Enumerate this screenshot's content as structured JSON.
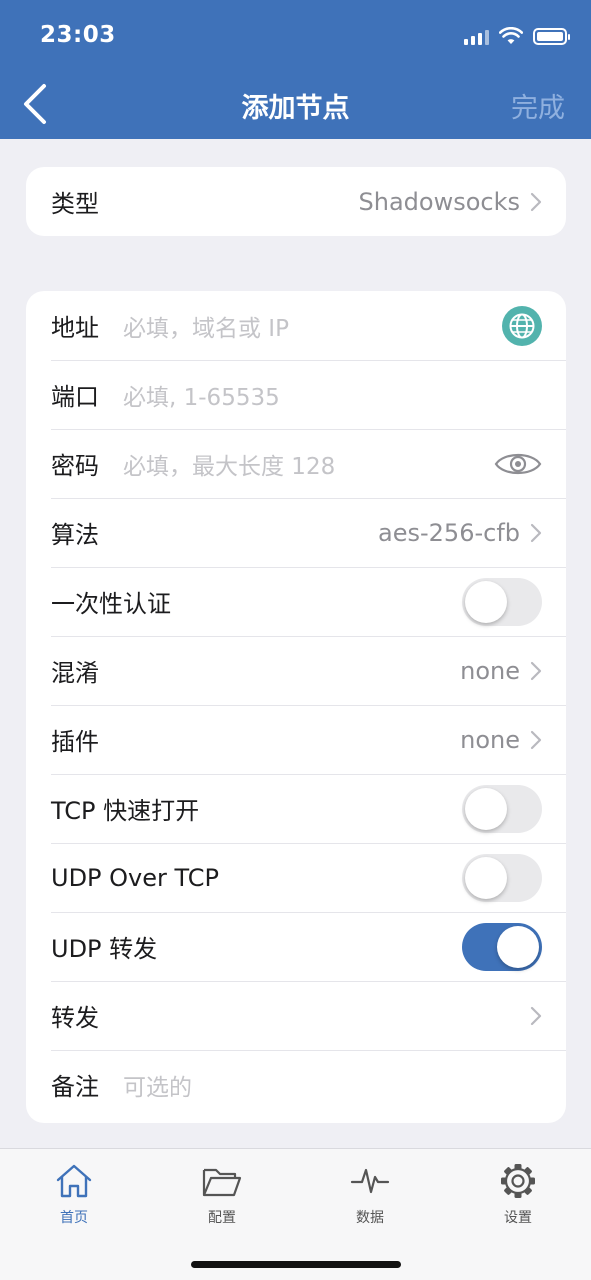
{
  "status": {
    "time": "23:03"
  },
  "nav": {
    "title": "添加节点",
    "done": "完成"
  },
  "type_row": {
    "label": "类型",
    "value": "Shadowsocks"
  },
  "form": {
    "address": {
      "label": "地址",
      "placeholder": "必填，域名或 IP"
    },
    "port": {
      "label": "端口",
      "placeholder": "必填, 1-65535"
    },
    "password": {
      "label": "密码",
      "placeholder": "必填，最大长度 128"
    },
    "algorithm": {
      "label": "算法",
      "value": "aes-256-cfb"
    },
    "ota": {
      "label": "一次性认证",
      "on": false
    },
    "obfs": {
      "label": "混淆",
      "value": "none"
    },
    "plugin": {
      "label": "插件",
      "value": "none"
    },
    "tcp_fast_open": {
      "label": "TCP 快速打开",
      "on": false
    },
    "udp_over_tcp": {
      "label": "UDP Over TCP",
      "on": false
    },
    "udp_relay": {
      "label": "UDP 转发",
      "on": true
    },
    "forward": {
      "label": "转发"
    },
    "remark": {
      "label": "备注",
      "placeholder": "可选的"
    }
  },
  "tabs": [
    {
      "label": "首页",
      "icon": "home-icon",
      "active": true
    },
    {
      "label": "配置",
      "icon": "folder-icon",
      "active": false
    },
    {
      "label": "数据",
      "icon": "pulse-icon",
      "active": false
    },
    {
      "label": "设置",
      "icon": "gear-icon",
      "active": false
    }
  ],
  "colors": {
    "accent": "#3f72b9",
    "globe": "#52b3ad",
    "background": "#efeff4"
  }
}
